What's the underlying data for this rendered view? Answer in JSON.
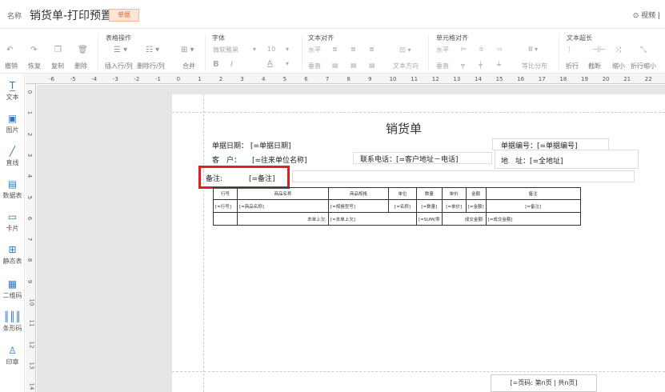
{
  "header": {
    "name_label": "名称",
    "title": "销货单-打印预置",
    "tag": "单据",
    "video_label": "⊙ 视频 |"
  },
  "toolbar": {
    "groups": [
      {
        "title": "表格操作"
      },
      {
        "title": "字体"
      },
      {
        "title": "文本对齐"
      },
      {
        "title": "单元格对齐"
      },
      {
        "title": "文本超长"
      }
    ],
    "undo": "撤销",
    "redo": "恢复",
    "copy": "复制",
    "delete": "删除",
    "insert_row_col": "插入行/列",
    "delete_row_col": "删除行/列",
    "merge": "合并",
    "font_name": "微软雅黑",
    "font_size": "10",
    "bold": "B",
    "italic": "I",
    "font_color": "A",
    "h_label": "水平",
    "v_label": "垂直",
    "text_dir": "文本方向",
    "cell_h_label": "水平",
    "cell_v_label": "垂直",
    "equal_dist": "等比分布",
    "wrap": "折行",
    "clip": "截断",
    "shrink": "缩小",
    "wrap_shrink": "折行缩小"
  },
  "left_panel": [
    {
      "label": "文本",
      "icon": "text-icon"
    },
    {
      "label": "图片",
      "icon": "image-icon"
    },
    {
      "label": "直线",
      "icon": "line-icon"
    },
    {
      "label": "数据表",
      "icon": "datatable-icon"
    },
    {
      "label": "卡片",
      "icon": "card-icon"
    },
    {
      "label": "静态表",
      "icon": "static-table-icon"
    },
    {
      "label": "二维码",
      "icon": "qrcode-icon"
    },
    {
      "label": "条形码",
      "icon": "barcode-icon"
    },
    {
      "label": "印章",
      "icon": "stamp-icon"
    }
  ],
  "hruler_labels": [
    "-6",
    "-5",
    "-4",
    "-3",
    "-2",
    "-1",
    "0",
    "1",
    "2",
    "3",
    "4",
    "5",
    "6",
    "7",
    "8",
    "9",
    "10",
    "11",
    "12",
    "13",
    "14",
    "15",
    "16",
    "17",
    "18",
    "19",
    "20",
    "21",
    "22"
  ],
  "vruler_labels": [
    "0",
    "1",
    "2",
    "3",
    "4",
    "5",
    "6",
    "7",
    "8",
    "9",
    "10",
    "11",
    "12",
    "13",
    "14"
  ],
  "doc": {
    "title": "销货单",
    "date_label": "单据日期：",
    "date_value": "[=单据日期]",
    "customer_label": "客　户：",
    "customer_value": "[=往来单位名称]",
    "phone": "联系电话：[=客户地址－电话]",
    "number": "单据编号：[=单据编号]",
    "address": "地　址：[=全地址]",
    "remark_label": "备注:",
    "remark_value": "[=备注]",
    "table": {
      "headers": [
        "行号",
        "商品名称",
        "商品规格",
        "单位",
        "数量",
        "单价",
        "金额",
        "备注"
      ],
      "row1": [
        "[=行号]",
        "[=商品名称]",
        "[=规格型号]",
        "[=名称]",
        "[=数量]",
        "[=单价]",
        "[=金额]",
        "[=备注]"
      ],
      "row2": {
        "prev_label": "本单上欠:",
        "prev_value": "[=本单上欠]",
        "sum": "[=SUM(零",
        "deal_label": "成交金额:",
        "deal_value": "[=成交金额]"
      }
    },
    "pager": "[=页码: 第n页 | 共n页]"
  },
  "colors": {
    "accent": "#2a78c7",
    "highlight": "#e02020",
    "tag_bg": "#fde6d8",
    "tag_text": "#e46a2b"
  }
}
